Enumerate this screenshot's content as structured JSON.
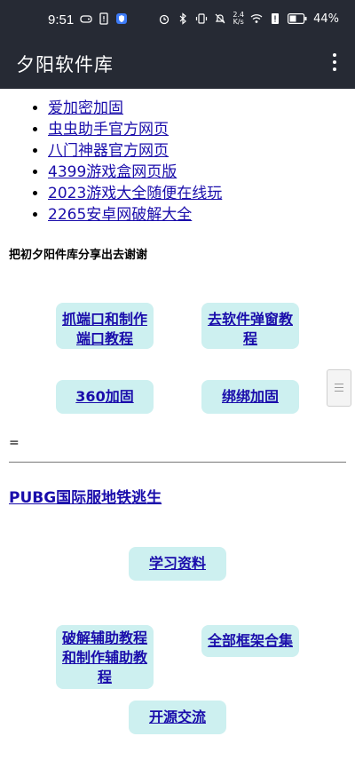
{
  "status_bar": {
    "time": "9:51",
    "net_speed": "2.4\nK/s",
    "battery": "44%"
  },
  "app_bar": {
    "title": "夕阳软件库"
  },
  "links": [
    "爱加密加固",
    "虫虫助手官方网页",
    "八门神器官方网页",
    "4399游戏盒网页版",
    "2023游戏大全随便在线玩",
    "2265安卓网破解大全"
  ],
  "note": "把初夕阳件库分享出去谢谢",
  "buttons_row1": [
    "抓端口和制作端口教程",
    "去软件弹窗教程"
  ],
  "buttons_row2": [
    "360加固",
    "绑绑加固"
  ],
  "equals": "=",
  "section_link": "PUBG国际服地铁逃生",
  "button_study": "学习资料",
  "buttons_row3": [
    "破解辅助教程和制作辅助教程",
    "全部框架合集"
  ],
  "button_open": "开源交流",
  "colors": {
    "bar_bg": "#262a34",
    "button_bg": "#cdf0f0",
    "link": "#1a0dab"
  }
}
